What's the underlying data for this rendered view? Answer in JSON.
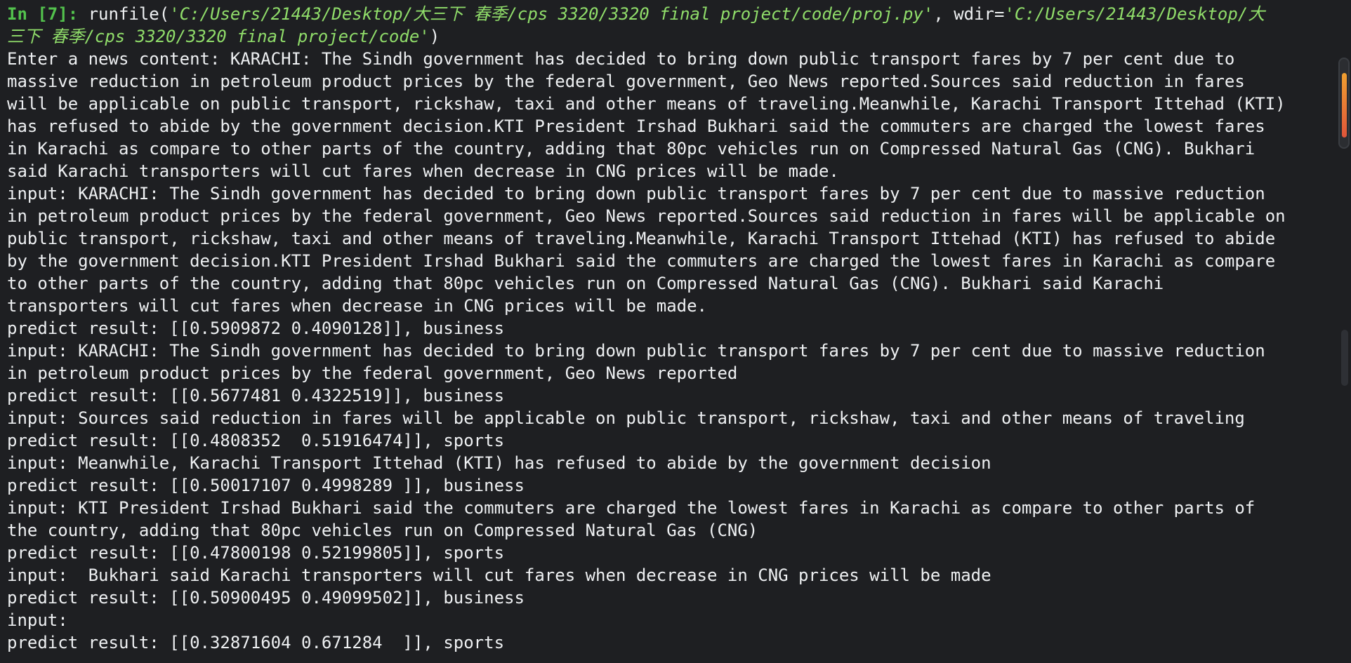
{
  "console": {
    "prompt": "In [7]:",
    "command": {
      "fn": " runfile(",
      "file_path_1": "'C:/Users/21443/Desktop/大三下 春季/cps 3320/3320 final project/code/proj.py'",
      "sep": ", wdir=",
      "wdir_part1": "'C:/Users/21443/Desktop/大",
      "wdir_part2": "三下 春季/cps 3320/3320 final project/code'",
      "close": ")"
    },
    "output_lines": [
      "Enter a news content: KARACHI: The Sindh government has decided to bring down public transport fares by 7 per cent due to",
      "massive reduction in petroleum product prices by the federal government, Geo News reported.Sources said reduction in fares",
      "will be applicable on public transport, rickshaw, taxi and other means of traveling.Meanwhile, Karachi Transport Ittehad (KTI)",
      "has refused to abide by the government decision.KTI President Irshad Bukhari said the commuters are charged the lowest fares",
      "in Karachi as compare to other parts of the country, adding that 80pc vehicles run on Compressed Natural Gas (CNG). Bukhari",
      "said Karachi transporters will cut fares when decrease in CNG prices will be made.",
      "input: KARACHI: The Sindh government has decided to bring down public transport fares by 7 per cent due to massive reduction",
      "in petroleum product prices by the federal government, Geo News reported.Sources said reduction in fares will be applicable on",
      "public transport, rickshaw, taxi and other means of traveling.Meanwhile, Karachi Transport Ittehad (KTI) has refused to abide",
      "by the government decision.KTI President Irshad Bukhari said the commuters are charged the lowest fares in Karachi as compare",
      "to other parts of the country, adding that 80pc vehicles run on Compressed Natural Gas (CNG). Bukhari said Karachi",
      "transporters will cut fares when decrease in CNG prices will be made.",
      "predict result: [[0.5909872 0.4090128]], business",
      "input: KARACHI: The Sindh government has decided to bring down public transport fares by 7 per cent due to massive reduction",
      "in petroleum product prices by the federal government, Geo News reported",
      "predict result: [[0.5677481 0.4322519]], business",
      "input: Sources said reduction in fares will be applicable on public transport, rickshaw, taxi and other means of traveling",
      "predict result: [[0.4808352  0.51916474]], sports",
      "input: Meanwhile, Karachi Transport Ittehad (KTI) has refused to abide by the government decision",
      "predict result: [[0.50017107 0.4998289 ]], business",
      "input: KTI President Irshad Bukhari said the commuters are charged the lowest fares in Karachi as compare to other parts of",
      "the country, adding that 80pc vehicles run on Compressed Natural Gas (CNG)",
      "predict result: [[0.47800198 0.52199805]], sports",
      "input:  Bukhari said Karachi transporters will cut fares when decrease in CNG prices will be made",
      "predict result: [[0.50900495 0.49099502]], business",
      "input:",
      "predict result: [[0.32871604 0.671284  ]], sports"
    ]
  },
  "colors": {
    "background": "#1e1f22",
    "text": "#eef0f2",
    "prompt": "#53c24d",
    "string": "#90dd6a"
  }
}
